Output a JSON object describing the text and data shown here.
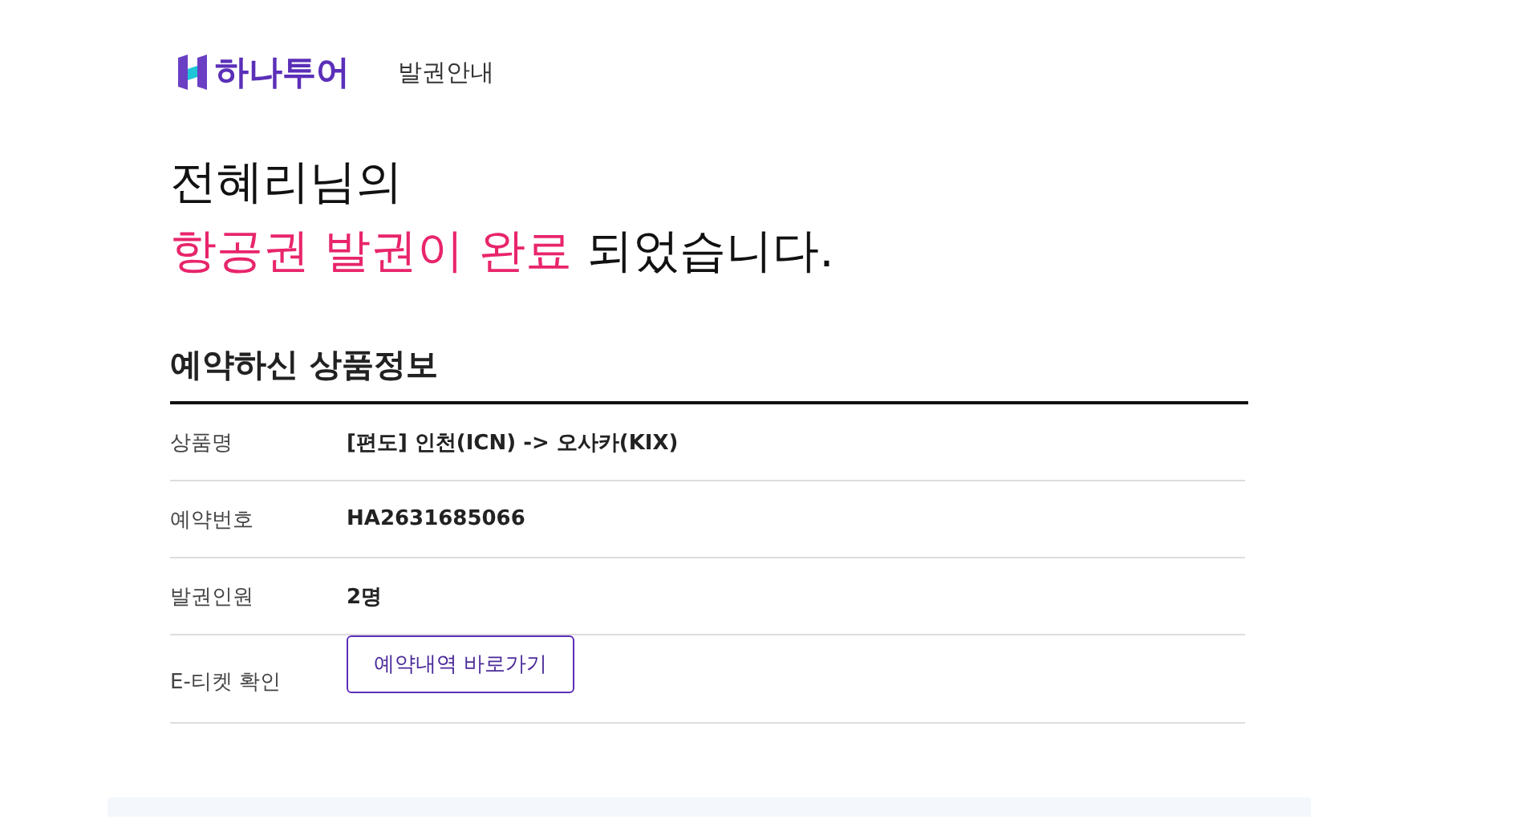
{
  "header": {
    "brand": "하나투어",
    "page_title": "발권안내"
  },
  "greeting": {
    "line_1": "전혜리님의",
    "line_2": [
      {
        "text": "항공권 발권이 완료",
        "highlight": true
      },
      {
        "text": " 되었습니다.",
        "highlight": false
      }
    ]
  },
  "section": {
    "title": "예약하신 상품정보",
    "rows": [
      {
        "kind": "text",
        "label": "상품명",
        "value": "[편도] 인천(ICN) -> 오사카(KIX)"
      },
      {
        "kind": "text",
        "label": "예약번호",
        "value": "HA2631685066"
      },
      {
        "kind": "text",
        "label": "발권인원",
        "value": "2명"
      },
      {
        "kind": "button",
        "label": "E-티켓 확인",
        "value": "예약내역 바로가기"
      }
    ]
  }
}
